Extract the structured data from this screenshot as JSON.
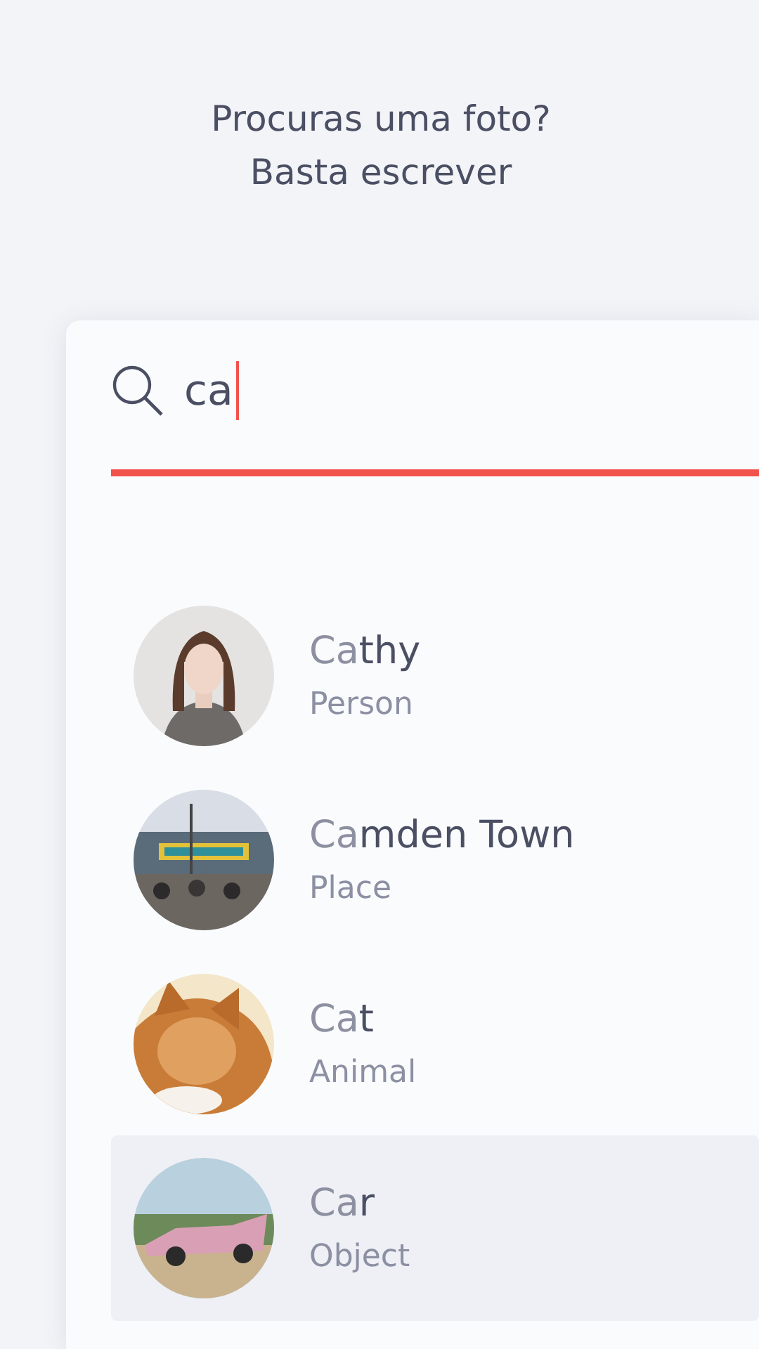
{
  "header": {
    "lines": [
      "Procuras uma foto?",
      "Basta escrever"
    ]
  },
  "search": {
    "value": "ca"
  },
  "results": [
    {
      "match": "Ca",
      "rest": "thy",
      "type": "Person",
      "kind": "person",
      "selected": false
    },
    {
      "match": "Ca",
      "rest": "mden Town",
      "type": "Place",
      "kind": "place",
      "selected": false
    },
    {
      "match": "Ca",
      "rest": "t",
      "type": "Animal",
      "kind": "animal",
      "selected": false
    },
    {
      "match": "Ca",
      "rest": "r",
      "type": "Object",
      "kind": "object",
      "selected": true
    }
  ]
}
